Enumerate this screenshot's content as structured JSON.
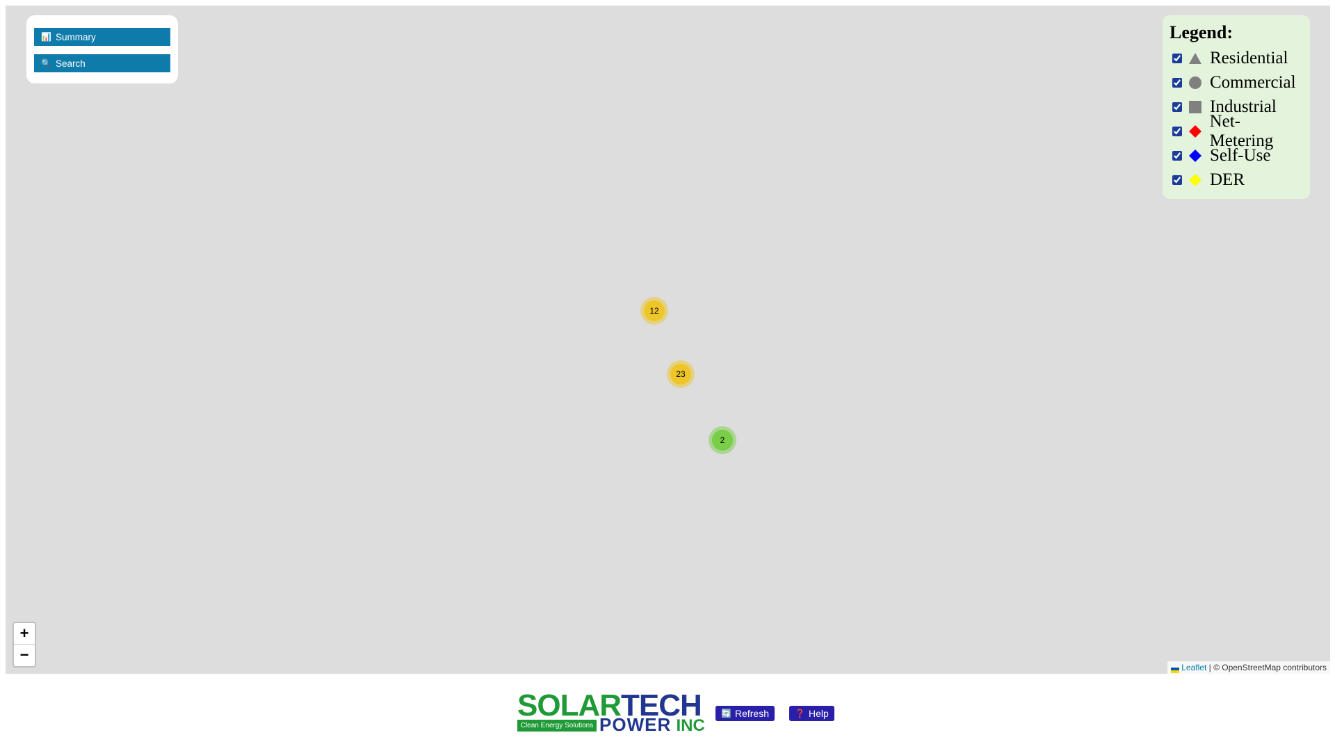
{
  "menu": {
    "summary_label": "Summary",
    "search_label": "Search"
  },
  "legend": {
    "title": "Legend:",
    "items": [
      {
        "label": "Residential",
        "symbol": "triangle",
        "color": "#808080",
        "checked": true
      },
      {
        "label": "Commercial",
        "symbol": "circle",
        "color": "#808080",
        "checked": true
      },
      {
        "label": "Industrial",
        "symbol": "square",
        "color": "#808080",
        "checked": true
      },
      {
        "label": "Net-Metering",
        "symbol": "diamond",
        "color": "#ff0000",
        "checked": true
      },
      {
        "label": "Self-Use",
        "symbol": "diamond",
        "color": "#0000ff",
        "checked": true
      },
      {
        "label": "DER",
        "symbol": "diamond",
        "color": "#ffff00",
        "checked": true
      }
    ]
  },
  "clusters": [
    {
      "count": "12",
      "color": "#f0c419"
    },
    {
      "count": "23",
      "color": "#f0c419"
    },
    {
      "count": "2",
      "color": "#6ecc39"
    }
  ],
  "zoom": {
    "in_label": "+",
    "out_label": "−"
  },
  "attribution": {
    "leaflet": "Leaflet",
    "separator": " | ",
    "osm": "© OpenStreetMap contributors"
  },
  "footer": {
    "logo_solar": "SOLAR",
    "logo_tech": "TECH",
    "logo_tagline": "Clean Energy Solutions",
    "logo_power": "POWER",
    "logo_inc": "INC",
    "refresh_label": "Refresh",
    "help_label": "Help"
  },
  "colors": {
    "menu_button": "#0f7bab",
    "footer_button": "#2a1fa8",
    "legend_bg": "#e4f4dc",
    "map_bg": "#dddddd"
  }
}
